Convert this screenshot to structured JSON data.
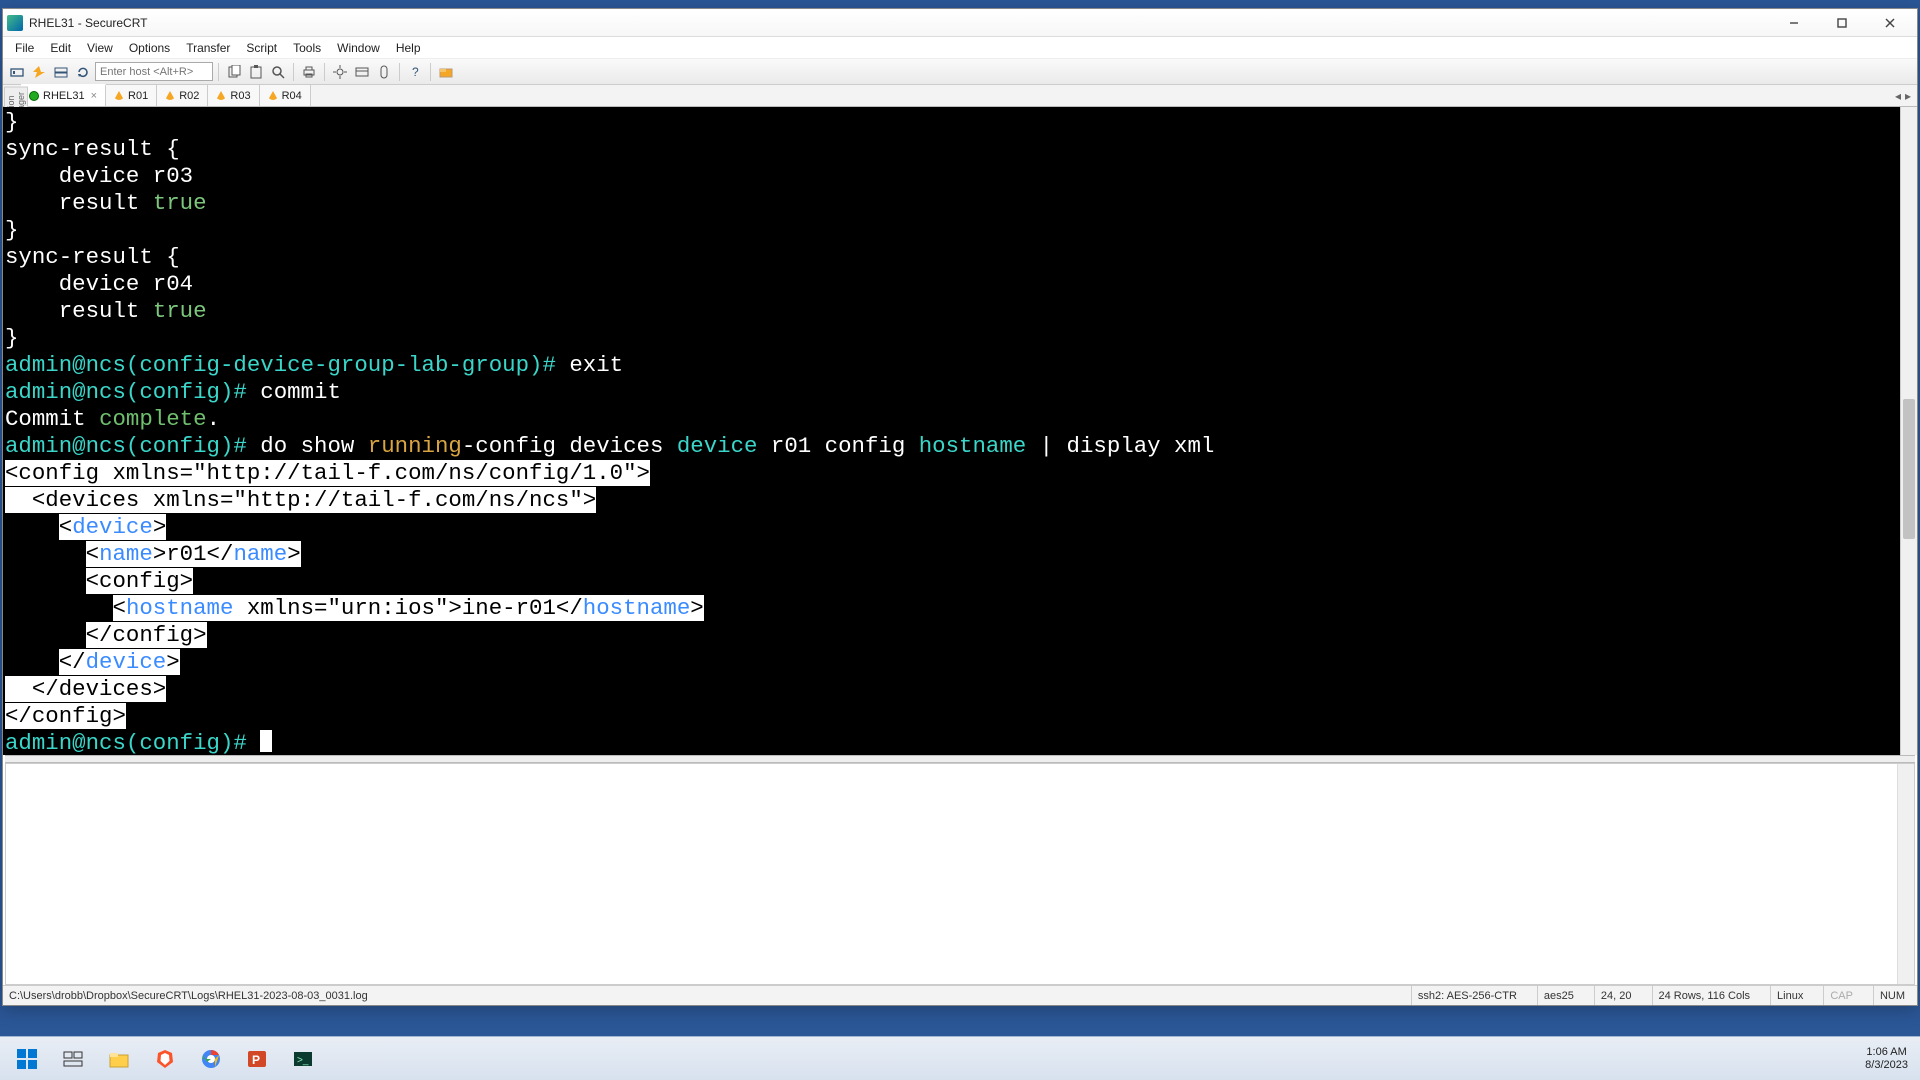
{
  "window": {
    "title": "RHEL31 - SecureCRT"
  },
  "menu": {
    "items": [
      "File",
      "Edit",
      "View",
      "Options",
      "Transfer",
      "Script",
      "Tools",
      "Window",
      "Help"
    ]
  },
  "toolbar": {
    "host_placeholder": "Enter host <Alt+R>"
  },
  "side_panel_label": "Session Manager",
  "tabs": [
    {
      "label": "RHEL31",
      "active": true,
      "ok": true
    },
    {
      "label": "R01",
      "active": false,
      "ok": false
    },
    {
      "label": "R02",
      "active": false,
      "ok": false
    },
    {
      "label": "R03",
      "active": false,
      "ok": false
    },
    {
      "label": "R04",
      "active": false,
      "ok": false
    }
  ],
  "terminal": {
    "lines": [
      {
        "segs": [
          {
            "t": "}",
            "cls": "c-white"
          }
        ]
      },
      {
        "segs": [
          {
            "t": "sync-result {",
            "cls": "c-white"
          }
        ]
      },
      {
        "segs": [
          {
            "t": "    device r03",
            "cls": "c-white"
          }
        ]
      },
      {
        "segs": [
          {
            "t": "    result ",
            "cls": "c-white"
          },
          {
            "t": "true",
            "cls": "c-green1"
          }
        ]
      },
      {
        "segs": [
          {
            "t": "}",
            "cls": "c-white"
          }
        ]
      },
      {
        "segs": [
          {
            "t": "sync-result {",
            "cls": "c-white"
          }
        ]
      },
      {
        "segs": [
          {
            "t": "    device r04",
            "cls": "c-white"
          }
        ]
      },
      {
        "segs": [
          {
            "t": "    result ",
            "cls": "c-white"
          },
          {
            "t": "true",
            "cls": "c-green1"
          }
        ]
      },
      {
        "segs": [
          {
            "t": "}",
            "cls": "c-white"
          }
        ]
      },
      {
        "segs": [
          {
            "t": "admin@ncs(config-device-group-lab-group)# ",
            "cls": "c-cyan"
          },
          {
            "t": "exit",
            "cls": "c-white"
          }
        ]
      },
      {
        "segs": [
          {
            "t": "admin@ncs(config)# ",
            "cls": "c-cyan"
          },
          {
            "t": "commit",
            "cls": "c-white"
          }
        ]
      },
      {
        "segs": [
          {
            "t": "Commit ",
            "cls": "c-white"
          },
          {
            "t": "complete",
            "cls": "c-green2"
          },
          {
            "t": ".",
            "cls": "c-white"
          }
        ]
      },
      {
        "segs": [
          {
            "t": "admin@ncs(config)# ",
            "cls": "c-cyan"
          },
          {
            "t": "do show ",
            "cls": "c-white"
          },
          {
            "t": "running",
            "cls": "c-amber"
          },
          {
            "t": "-config devices ",
            "cls": "c-white"
          },
          {
            "t": "device",
            "cls": "c-cyan"
          },
          {
            "t": " r01 config ",
            "cls": "c-white"
          },
          {
            "t": "hostname",
            "cls": "c-cyan"
          },
          {
            "t": " | display xml",
            "cls": "c-white"
          }
        ]
      },
      {
        "segs": [
          {
            "t": "<config xmlns=\"http://tail-f.com/ns/config/1.0\">",
            "cls": "hl"
          }
        ]
      },
      {
        "segs": [
          {
            "t": "  <devices xmlns=\"http://tail-f.com/ns/ncs\">",
            "cls": "hl"
          }
        ]
      },
      {
        "segs": [
          {
            "t": "    ",
            "cls": "c-white"
          },
          {
            "t": "<",
            "cls": "hl"
          },
          {
            "t": "device",
            "cls": "hl-blue"
          },
          {
            "t": ">",
            "cls": "hl"
          }
        ]
      },
      {
        "segs": [
          {
            "t": "      ",
            "cls": "c-white"
          },
          {
            "t": "<",
            "cls": "hl"
          },
          {
            "t": "name",
            "cls": "hl-blue"
          },
          {
            "t": ">r01</",
            "cls": "hl"
          },
          {
            "t": "name",
            "cls": "hl-blue"
          },
          {
            "t": ">",
            "cls": "hl"
          }
        ]
      },
      {
        "segs": [
          {
            "t": "      ",
            "cls": "c-white"
          },
          {
            "t": "<config>",
            "cls": "hl"
          }
        ]
      },
      {
        "segs": [
          {
            "t": "        ",
            "cls": "c-white"
          },
          {
            "t": "<",
            "cls": "hl"
          },
          {
            "t": "hostname",
            "cls": "hl-blue"
          },
          {
            "t": " xmlns=\"urn:ios\">ine-r01</",
            "cls": "hl"
          },
          {
            "t": "hostname",
            "cls": "hl-blue"
          },
          {
            "t": ">",
            "cls": "hl"
          }
        ]
      },
      {
        "segs": [
          {
            "t": "      ",
            "cls": "c-white"
          },
          {
            "t": "</config>",
            "cls": "hl"
          }
        ]
      },
      {
        "segs": [
          {
            "t": "    ",
            "cls": "c-white"
          },
          {
            "t": "</",
            "cls": "hl"
          },
          {
            "t": "device",
            "cls": "hl-blue"
          },
          {
            "t": ">",
            "cls": "hl"
          }
        ]
      },
      {
        "segs": [
          {
            "t": "  </devices>",
            "cls": "hl"
          }
        ]
      },
      {
        "segs": [
          {
            "t": "</config>",
            "cls": "hl"
          }
        ]
      },
      {
        "segs": [
          {
            "t": "admin@ncs(config)# ",
            "cls": "c-cyan"
          },
          {
            "cursor": true
          }
        ]
      }
    ]
  },
  "status": {
    "log_path": "C:\\Users\\drobb\\Dropbox\\SecureCRT\\Logs\\RHEL31-2023-08-03_0031.log",
    "cipher": "ssh2: AES-256-CTR",
    "aes": "aes25",
    "pos": "24, 20",
    "size": "24 Rows, 116 Cols",
    "os": "Linux",
    "cap": "CAP",
    "num": "NUM"
  },
  "clock": {
    "time": "1:06 AM",
    "date": "8/3/2023"
  }
}
